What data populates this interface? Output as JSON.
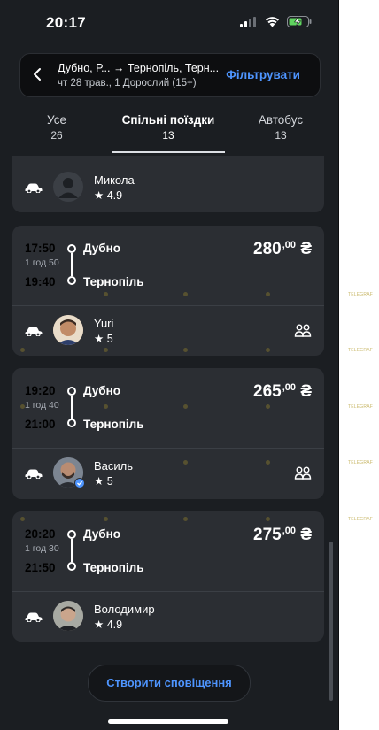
{
  "status": {
    "time": "20:17"
  },
  "search": {
    "route": "Дубно, Р... → Тернопіль, Терн...",
    "details": "чт 28 трав., 1 Дорослий (15+)",
    "filter_label": "Фільтрувати"
  },
  "tabs": [
    {
      "label": "Усе",
      "count": "26"
    },
    {
      "label": "Спільні поїздки",
      "count": "13"
    },
    {
      "label": "Автобус",
      "count": "13"
    }
  ],
  "partial_card": {
    "driver": "Микола",
    "rating": "4.9"
  },
  "rides": [
    {
      "depart": "17:50",
      "duration": "1 год 50",
      "arrive": "19:40",
      "from": "Дубно",
      "to": "Тернопіль",
      "price_main": "280",
      "price_cents": ",00",
      "currency": "₴",
      "driver": "Yuri",
      "rating": "5"
    },
    {
      "depart": "19:20",
      "duration": "1 год 40",
      "arrive": "21:00",
      "from": "Дубно",
      "to": "Тернопіль",
      "price_main": "265",
      "price_cents": ",00",
      "currency": "₴",
      "driver": "Василь",
      "rating": "5"
    },
    {
      "depart": "20:20",
      "duration": "1 год 30",
      "arrive": "21:50",
      "from": "Дубно",
      "to": "Тернопіль",
      "price_main": "275",
      "price_cents": ",00",
      "currency": "₴",
      "driver": "Володимир",
      "rating": "4.9"
    }
  ],
  "notify_button": "Створити сповіщення",
  "watermark": "TELEGRAF",
  "colors": {
    "accent": "#4e95ff",
    "background": "#1b1e22",
    "card": "#2b2e33"
  }
}
